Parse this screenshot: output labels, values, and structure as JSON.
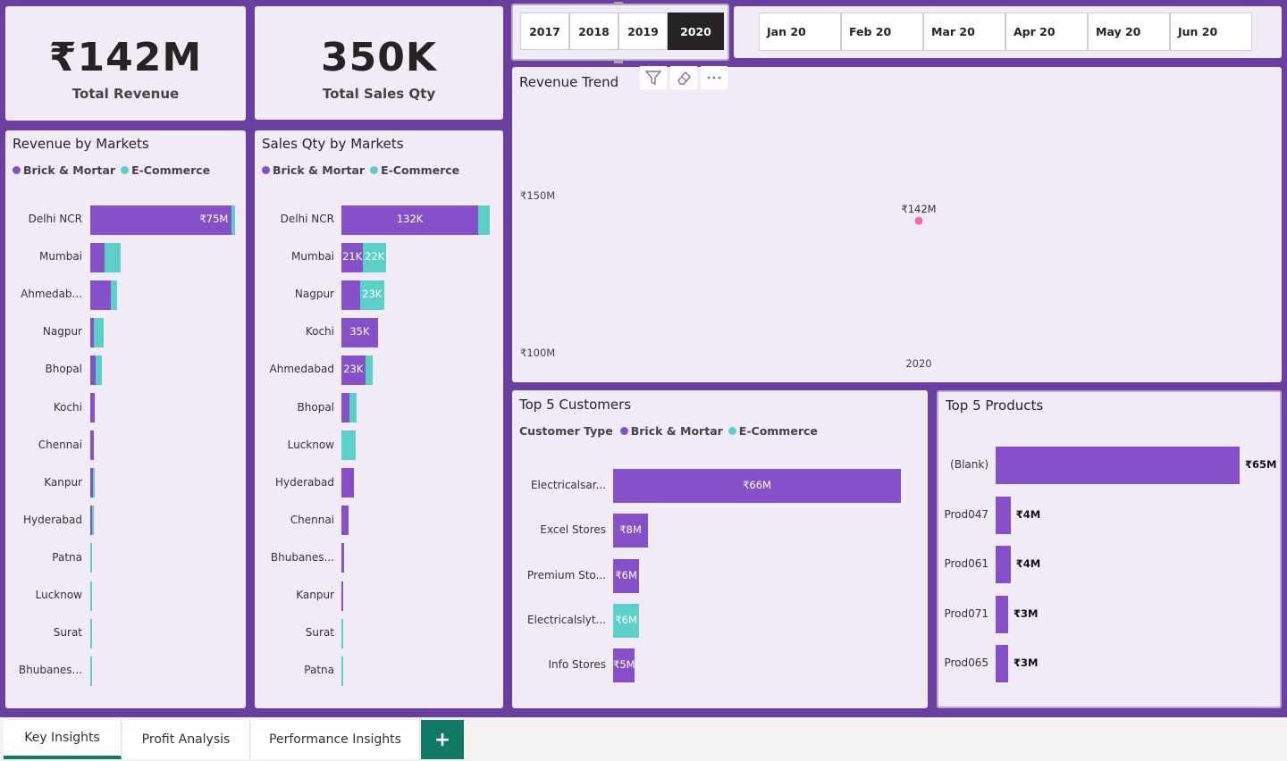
{
  "colors": {
    "brick_mortar": "#8550c8",
    "ecommerce": "#5ccfc9",
    "canvas": "#6b3fa0",
    "card": "#f0ebf6",
    "active_tab": "#117865",
    "trend_point": "#f06ab0"
  },
  "kpis": {
    "revenue": {
      "value": "₹142M",
      "label": "Total Revenue"
    },
    "qty": {
      "value": "350K",
      "label": "Total Sales Qty"
    }
  },
  "year_slicer": {
    "options": [
      "2017",
      "2018",
      "2019",
      "2020"
    ],
    "selected": "2020"
  },
  "month_slicer": {
    "options": [
      "Jan 20",
      "Feb 20",
      "Mar 20",
      "Apr 20",
      "May 20",
      "Jun 20"
    ]
  },
  "legend": {
    "brick": "Brick & Mortar",
    "ecom": "E-Commerce",
    "customer_type": "Customer Type"
  },
  "revenue_by_markets": {
    "title": "Revenue by Markets",
    "chart_data": {
      "type": "bar",
      "unit": "₹M",
      "categories": [
        "Delhi NCR",
        "Mumbai",
        "Ahmedab...",
        "Nagpur",
        "Bhopal",
        "Kochi",
        "Chennai",
        "Kanpur",
        "Hyderabad",
        "Patna",
        "Lucknow",
        "Surat",
        "Bhubanes..."
      ],
      "series": [
        {
          "name": "Brick & Mortar",
          "values": [
            73.5,
            7.3,
            10.8,
            2.0,
            3.0,
            2.1,
            1.8,
            1.2,
            0.9,
            0.15,
            0.1,
            0.1,
            0.05
          ]
        },
        {
          "name": "E-Commerce",
          "values": [
            1.7,
            8.5,
            3.2,
            5.2,
            3.2,
            0,
            0,
            0.2,
            0.1,
            0.6,
            0.6,
            0.4,
            0.2
          ]
        }
      ],
      "labels": [
        "₹75M",
        "",
        "",
        "",
        "",
        "",
        "",
        "",
        "",
        "",
        "",
        "",
        ""
      ],
      "xlim": [
        0,
        75.2
      ]
    }
  },
  "qty_by_markets": {
    "title": "Sales Qty by Markets",
    "chart_data": {
      "type": "bar",
      "unit": "K",
      "categories": [
        "Delhi NCR",
        "Mumbai",
        "Nagpur",
        "Kochi",
        "Ahmedabad",
        "Bhopal",
        "Lucknow",
        "Hyderabad",
        "Chennai",
        "Bhubanes...",
        "Kanpur",
        "Surat",
        "Patna"
      ],
      "series": [
        {
          "name": "Brick & Mortar",
          "labels": [
            "132K",
            "21K",
            "",
            "35K",
            "23K",
            "",
            "",
            "",
            "",
            "",
            "",
            "",
            ""
          ],
          "values": [
            132,
            21,
            18,
            35,
            23,
            8,
            0,
            12,
            7,
            3,
            2,
            0,
            0
          ]
        },
        {
          "name": "E-Commerce",
          "labels": [
            "",
            "22K",
            "23K",
            "",
            "",
            "",
            "",
            "",
            "",
            "",
            "",
            "",
            ""
          ],
          "values": [
            11,
            22,
            23,
            0,
            7,
            7,
            14,
            0,
            0,
            0,
            0,
            2,
            1
          ]
        }
      ],
      "xlim": [
        0,
        143
      ]
    }
  },
  "revenue_trend": {
    "title": "Revenue Trend",
    "chart_data": {
      "type": "line",
      "x": [
        "2020"
      ],
      "y": [
        142
      ],
      "point_labels": [
        "₹142M"
      ],
      "ylim": [
        100,
        150
      ],
      "yticks": [
        "₹150M",
        "₹100M"
      ]
    }
  },
  "top_customers": {
    "title": "Top 5 Customers",
    "chart_data": {
      "type": "bar",
      "categories": [
        "Electricalsar...",
        "Excel Stores",
        "Premium Sto...",
        "Electricalslyt...",
        "Info Stores"
      ],
      "values": [
        66,
        8,
        6,
        6,
        5
      ],
      "labels": [
        "₹66M",
        "₹8M",
        "₹6M",
        "₹6M",
        "₹5M"
      ],
      "types": [
        "brick",
        "brick",
        "brick",
        "ecom",
        "brick"
      ],
      "xlim": [
        0,
        66
      ]
    }
  },
  "top_products": {
    "title": "Top 5 Products",
    "chart_data": {
      "type": "bar",
      "categories": [
        "(Blank)",
        "Prod047",
        "Prod061",
        "Prod071",
        "Prod065"
      ],
      "values": [
        65,
        4,
        4,
        3,
        3
      ],
      "labels": [
        "₹65M",
        "₹4M",
        "₹4M",
        "₹3M",
        "₹3M"
      ],
      "xlim": [
        0,
        65
      ]
    }
  },
  "tabs": [
    "Key Insights",
    "Profit Analysis",
    "Performance Insights"
  ],
  "tab_add": "+",
  "toolbar_icons": [
    "filter-icon",
    "eraser-icon",
    "more-options-icon"
  ]
}
